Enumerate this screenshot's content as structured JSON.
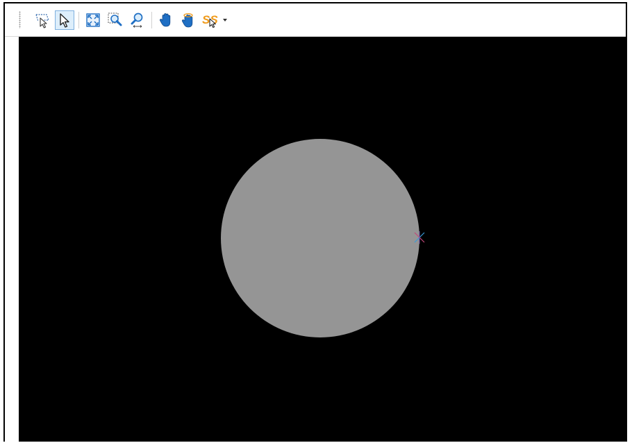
{
  "toolbar": {
    "tools": [
      {
        "icon": "lasso-select-icon",
        "active": false
      },
      {
        "icon": "pointer-select-icon",
        "active": true
      },
      {
        "icon": "zoom-extents-icon",
        "active": false
      },
      {
        "icon": "zoom-window-icon",
        "active": false
      },
      {
        "icon": "zoom-realtime-icon",
        "active": false
      },
      {
        "icon": "pan-hand-icon",
        "active": false
      },
      {
        "icon": "orbit-hand-icon",
        "active": false
      },
      {
        "icon": "snap-settings-icon",
        "active": false
      }
    ]
  },
  "viewport": {
    "background_color": "#000000",
    "shape": "circle",
    "shape_fill": "#959595",
    "marker_colors": [
      "#c4487a",
      "#3a9bd8",
      "#6b4ea8"
    ]
  },
  "colors": {
    "accent_active": "#ddeefb",
    "accent_border": "#7fb0df",
    "icon_blue": "#1f6fc4",
    "icon_orange": "#f09a1a"
  }
}
